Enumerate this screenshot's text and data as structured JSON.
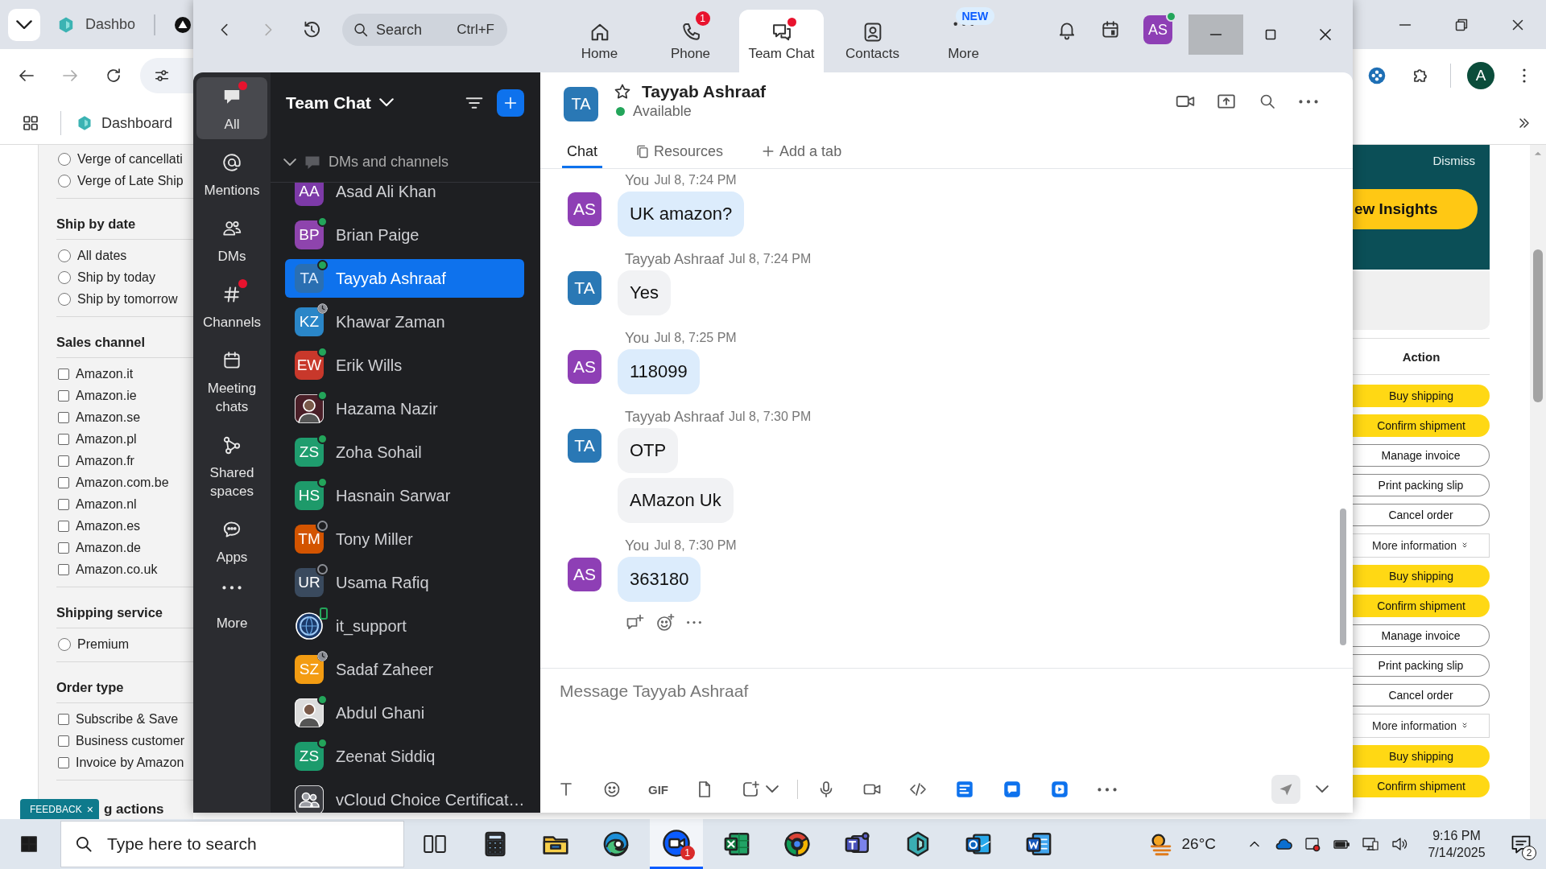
{
  "browser": {
    "tab_title": "Dashbo",
    "bookmark": "Dashboard",
    "profile_initial": "A",
    "filters": [
      {
        "kind": "radio",
        "options": [
          {
            "label": "Verge of cancellati",
            "checked": false
          },
          {
            "label": "Verge of Late Ship",
            "checked": false
          }
        ]
      },
      {
        "heading": "Ship by date",
        "kind": "radio",
        "options": [
          {
            "label": "All dates",
            "checked": false
          },
          {
            "label": "Ship by today",
            "checked": false
          },
          {
            "label": "Ship by tomorrow",
            "checked": false
          }
        ]
      },
      {
        "heading": "Sales channel",
        "kind": "checkbox",
        "options": [
          {
            "label": "Amazon.it",
            "checked": false
          },
          {
            "label": "Amazon.ie",
            "checked": false
          },
          {
            "label": "Amazon.se",
            "checked": false
          },
          {
            "label": "Amazon.pl",
            "checked": false
          },
          {
            "label": "Amazon.fr",
            "checked": false
          },
          {
            "label": "Amazon.com.be",
            "checked": false
          },
          {
            "label": "Amazon.nl",
            "checked": false
          },
          {
            "label": "Amazon.es",
            "checked": false
          },
          {
            "label": "Amazon.de",
            "checked": false
          },
          {
            "label": "Amazon.co.uk",
            "checked": false
          }
        ]
      },
      {
        "heading": "Shipping service",
        "kind": "radio",
        "options": [
          {
            "label": "Premium",
            "checked": false
          }
        ]
      },
      {
        "heading": "Order type",
        "kind": "checkbox",
        "options": [
          {
            "label": "Subscribe & Save",
            "checked": false
          },
          {
            "label": "Business customer",
            "checked": false
          },
          {
            "label": "Invoice by Amazon",
            "checked": false
          }
        ]
      }
    ],
    "feedback": {
      "label": "FEEDBACK",
      "close": "×",
      "next_heading": "g actions"
    },
    "insights": {
      "dismiss": "Dismiss",
      "button": "ew Insights"
    },
    "actions": {
      "heading": "Action",
      "orders": [
        {
          "buttons": [
            {
              "label": "Buy shipping",
              "kind": "primary"
            },
            {
              "label": "Confirm shipment",
              "kind": "primary"
            },
            {
              "label": "Manage invoice",
              "kind": "secondary"
            },
            {
              "label": "Print packing slip",
              "kind": "secondary"
            },
            {
              "label": "Cancel order",
              "kind": "secondary"
            }
          ],
          "more": "More information"
        },
        {
          "buttons": [
            {
              "label": "Buy shipping",
              "kind": "primary"
            },
            {
              "label": "Confirm shipment",
              "kind": "primary"
            },
            {
              "label": "Manage invoice",
              "kind": "secondary"
            },
            {
              "label": "Print packing slip",
              "kind": "secondary"
            },
            {
              "label": "Cancel order",
              "kind": "secondary"
            }
          ],
          "more": "More information"
        },
        {
          "buttons": [
            {
              "label": "Buy shipping",
              "kind": "primary"
            },
            {
              "label": "Confirm shipment",
              "kind": "primary"
            }
          ]
        }
      ]
    }
  },
  "zoom": {
    "search": {
      "placeholder": "Search",
      "shortcut": "Ctrl+F"
    },
    "nav": [
      {
        "label": "Home",
        "kind": "home",
        "selected": false,
        "unread": false
      },
      {
        "label": "Phone",
        "kind": "phone",
        "selected": false,
        "unread": false,
        "badge": "1"
      },
      {
        "label": "Team Chat",
        "kind": "chat",
        "selected": true,
        "unread": true
      },
      {
        "label": "Contacts",
        "kind": "contacts",
        "selected": false,
        "unread": false
      },
      {
        "label": "More",
        "kind": "more",
        "selected": false,
        "unread": false,
        "tag": "NEW"
      }
    ],
    "user": {
      "initials": "AS",
      "status": {
        "kind": "available"
      }
    },
    "rail": [
      {
        "label": "All",
        "kind": "all",
        "selected": true,
        "unread": true
      },
      {
        "label": "Mentions",
        "kind": "mentions",
        "selected": false,
        "unread": false
      },
      {
        "label": "DMs",
        "kind": "dms",
        "selected": false,
        "unread": false
      },
      {
        "label": "Channels",
        "kind": "channels",
        "selected": false,
        "unread": true
      },
      {
        "label": "Meeting chats",
        "kind": "meetings",
        "selected": false,
        "unread": false
      },
      {
        "label": "Shared spaces",
        "kind": "spaces",
        "selected": false,
        "unread": false
      },
      {
        "label": "Apps",
        "kind": "apps",
        "selected": false,
        "unread": false
      },
      {
        "label": "More",
        "kind": "more",
        "selected": false,
        "unread": false
      }
    ],
    "list": {
      "title": "Team Chat",
      "section": {
        "label": "DMs and channels",
        "expanded": true
      },
      "contacts": [
        {
          "name": "Asad Ali Khan",
          "initials": "AA",
          "kind": "initials",
          "color": "#7d3aa8",
          "selected": false
        },
        {
          "name": "Brian Paige",
          "initials": "BP",
          "kind": "initials",
          "color": "#8e44ad",
          "status": {
            "kind": "available"
          },
          "selected": false
        },
        {
          "name": "Tayyab Ashraaf",
          "initials": "TA",
          "kind": "initials",
          "color": "#2f6fa8",
          "status": {
            "kind": "available"
          },
          "selected": true
        },
        {
          "name": "Khawar Zaman",
          "initials": "KZ",
          "kind": "initials",
          "color": "#2a86c8",
          "status": {
            "kind": "away"
          },
          "selected": false
        },
        {
          "name": "Erik Wills",
          "initials": "EW",
          "kind": "initials",
          "color": "#c8382b",
          "status": {
            "kind": "available"
          },
          "selected": false
        },
        {
          "name": "Hazama Nazir",
          "color": "#4a1f28",
          "status": {
            "kind": "available"
          },
          "selected": false
        },
        {
          "name": "Zoha Sohail",
          "initials": "ZS",
          "kind": "initials",
          "color": "#1f9d6e",
          "status": {
            "kind": "available"
          },
          "selected": false
        },
        {
          "name": "Hasnain Sarwar",
          "initials": "HS",
          "kind": "initials",
          "color": "#1e9a6a",
          "status": {
            "kind": "available"
          },
          "selected": false
        },
        {
          "name": "Tony Miller",
          "initials": "TM",
          "kind": "initials",
          "color": "#d35400",
          "status": {
            "kind": "offline"
          },
          "selected": false
        },
        {
          "name": "Usama Rafiq",
          "initials": "UR",
          "kind": "initials",
          "color": "#3a4a5e",
          "status": {
            "kind": "offline"
          },
          "selected": false
        },
        {
          "name": "it_support",
          "kind": "logo",
          "color": "#1b3a6b",
          "status": {
            "kind": "mobile"
          },
          "selected": false
        },
        {
          "name": "Sadaf Zaheer",
          "initials": "SZ",
          "kind": "initials",
          "color": "#f39c12",
          "status": {
            "kind": "away"
          },
          "selected": false
        },
        {
          "name": "Abdul Ghani",
          "color": "#dcdcdc",
          "status": {
            "kind": "available"
          },
          "selected": false
        },
        {
          "name": "Zeenat Siddiq",
          "initials": "ZS",
          "kind": "initials",
          "color": "#1c9b6c",
          "status": {
            "kind": "available"
          },
          "selected": false
        },
        {
          "name": "vCloud Choice Certificat…",
          "kind": "group",
          "color": "#3a3b40",
          "selected": false
        }
      ]
    },
    "chat": {
      "name": "Tayyab Ashraaf",
      "initials": "TA",
      "starred": false,
      "presence": "Available",
      "status": {
        "kind": "available"
      },
      "tabs": [
        {
          "label": "Chat",
          "kind": "chat",
          "selected": true
        },
        {
          "label": "Resources",
          "kind": "resources",
          "selected": false
        },
        {
          "label": "Add a tab",
          "kind": "add",
          "selected": false
        }
      ],
      "messages": [
        {
          "sender": "You",
          "time": "Jul 8, 7:24 PM",
          "initials": "AS",
          "own": true,
          "bubbles": [
            "UK amazon?"
          ]
        },
        {
          "sender": "Tayyab Ashraaf",
          "time": "Jul 8, 7:24 PM",
          "initials": "TA",
          "own": false,
          "bubbles": [
            "Yes"
          ]
        },
        {
          "sender": "You",
          "time": "Jul 8, 7:25 PM",
          "initials": "AS",
          "own": true,
          "bubbles": [
            "118099"
          ]
        },
        {
          "sender": "Tayyab Ashraaf",
          "time": "Jul 8, 7:30 PM",
          "initials": "TA",
          "own": false,
          "bubbles": [
            "OTP",
            "AMazon Uk"
          ]
        },
        {
          "sender": "You",
          "time": "Jul 8, 7:30 PM",
          "initials": "AS",
          "own": true,
          "bubbles": [
            "363180"
          ]
        }
      ],
      "composer": {
        "placeholder": "Message Tayyab Ashraaf",
        "gif": "GIF"
      }
    }
  },
  "taskbar": {
    "search_placeholder": "Type here to search",
    "apps": [
      {
        "kind": "task-view",
        "active": false
      },
      {
        "kind": "calculator",
        "active": false
      },
      {
        "kind": "folder",
        "active": false
      },
      {
        "kind": "edge",
        "active": false
      },
      {
        "kind": "zoom",
        "active": true,
        "badge": "1"
      },
      {
        "kind": "spreadsheet",
        "active": false
      },
      {
        "kind": "chrome",
        "active": false
      },
      {
        "kind": "teams",
        "active": false
      },
      {
        "kind": "hexagon",
        "active": false
      },
      {
        "kind": "mail",
        "active": false
      },
      {
        "kind": "document",
        "active": false
      }
    ],
    "weather": "26°C",
    "time": "9:16 PM",
    "date": "7/14/2025",
    "notifications": "2"
  }
}
